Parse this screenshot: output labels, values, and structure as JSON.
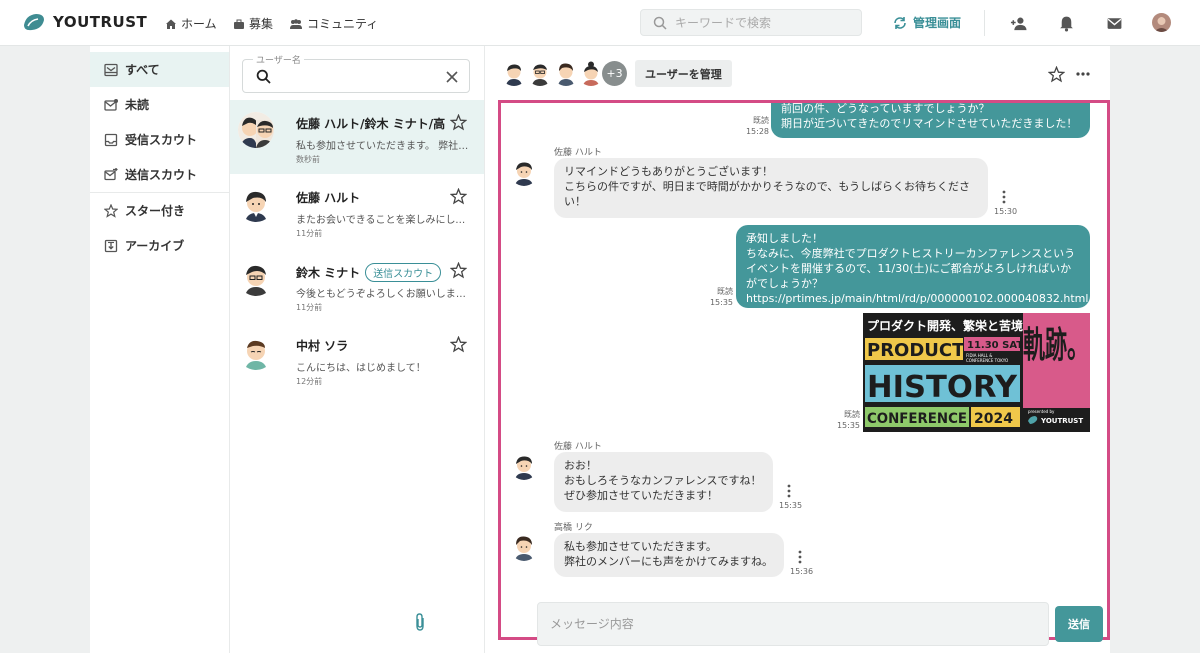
{
  "header": {
    "logo_text": "YOUTRUST",
    "nav": [
      {
        "label": "ホーム",
        "icon": "home-icon"
      },
      {
        "label": "募集",
        "icon": "briefcase-icon"
      },
      {
        "label": "コミュニティ",
        "icon": "people-icon"
      }
    ],
    "search_placeholder": "キーワードで検索",
    "admin_label": "管理画面",
    "icons": [
      "add-user-icon",
      "bell-icon",
      "mail-icon",
      "avatar"
    ]
  },
  "sidebar": {
    "items": [
      {
        "label": "すべて",
        "icon": "inbox-icon",
        "active": true
      },
      {
        "label": "未読",
        "icon": "unread-mail-icon"
      },
      {
        "label": "受信スカウト",
        "icon": "tray-icon"
      },
      {
        "label": "送信スカウト",
        "icon": "send-mail-icon"
      },
      {
        "label": "スター付き",
        "icon": "star-icon"
      },
      {
        "label": "アーカイブ",
        "icon": "archive-icon"
      }
    ]
  },
  "conversations": {
    "search_label": "ユーザー名",
    "search_value": "",
    "items": [
      {
        "name": "佐藤 ハルト/鈴木 ミナト/高...",
        "preview": "私も参加させていただきます。 弊社の...",
        "time": "数秒前",
        "active": true
      },
      {
        "name": "佐藤 ハルト",
        "preview": "またお会いできることを楽しみにして...",
        "time": "11分前"
      },
      {
        "name": "鈴木 ミナト",
        "badge": "送信スカウト",
        "preview": "今後ともどうぞよろしくお願いします！",
        "time": "11分前"
      },
      {
        "name": "中村 ソラ",
        "preview": "こんにちは、はじめまして！",
        "time": "12分前"
      }
    ]
  },
  "chat": {
    "more_members": "+3",
    "manage_label": "ユーザーを管理",
    "messages": [
      {
        "dir": "out",
        "text": "前回の件、どうなっていますでしょうか？\n期日が近づいてきたのでリマインドさせていただきました！",
        "read": "既読",
        "time": "15:28"
      },
      {
        "dir": "in",
        "sender": "佐藤 ハルト",
        "text": "リマインドどうもありがとうございます！\nこちらの件ですが、明日まで時間がかかりそうなので、もうしばらくお待ちください！",
        "time": "15:30"
      },
      {
        "dir": "out",
        "text": "承知しました！\nちなみに、今度弊社でプロダクトヒストリーカンファレンスというイベントを開催するので、11/30(土)にご都合がよろしければいかがでしょうか？\nhttps://prtimes.jp/main/html/rd/p/000000102.000040832.html",
        "read": "既読",
        "time": "15:35"
      },
      {
        "dir": "out",
        "type": "image",
        "read": "既読",
        "time": "15:35"
      },
      {
        "dir": "in",
        "sender": "佐藤 ハルト",
        "text": "おお！\nおもしろそうなカンファレンスですね！\nぜひ参加させていただきます！",
        "time": "15:35"
      },
      {
        "dir": "in",
        "sender": "高橋 リク",
        "text": "私も参加させていただきます。\n弊社のメンバーにも声をかけてみますね。",
        "time": "15:36"
      }
    ],
    "banner": {
      "top": "プロダクト開発、繁栄と苦境の",
      "date": "11.30 SAT",
      "venue_1": "FIDIA HALL &",
      "venue_2": "CONFERENCE TOKYO",
      "line1": "PRODUCT",
      "line2": "HISTORY",
      "line3": "CONFERENCE",
      "year": "2024",
      "kanji": "軌跡。",
      "presented": "presented by",
      "brand": "YOUTRUST"
    },
    "input_placeholder": "メッセージ内容",
    "send_label": "送信"
  },
  "colors": {
    "accent": "#44979a",
    "highlight_border": "#d44b85",
    "active_bg": "#e8f3f2"
  }
}
